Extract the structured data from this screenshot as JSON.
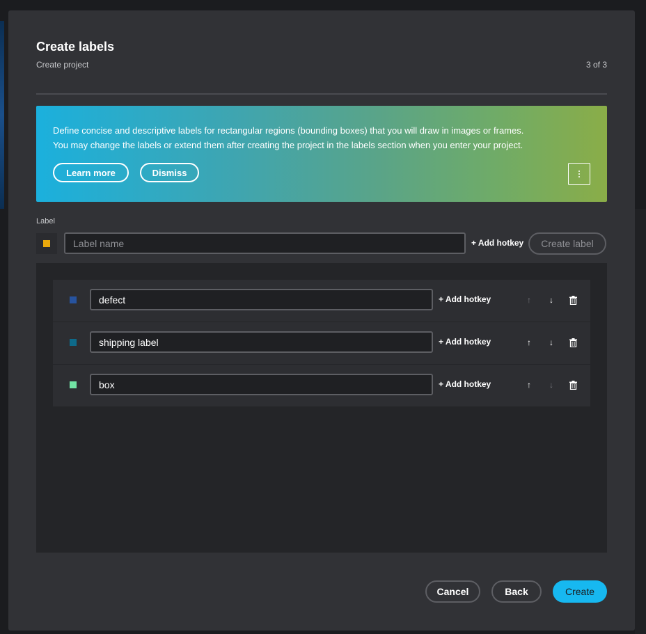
{
  "dialog": {
    "title": "Create labels",
    "subtitle": "Create project",
    "step": "3 of 3"
  },
  "banner": {
    "line1": "Define concise and descriptive labels for rectangular regions (bounding boxes) that you will draw in images or frames.",
    "line2": "You may change the labels or extend them after creating the project in the labels section when you enter your project.",
    "learn_more": "Learn more",
    "dismiss": "Dismiss",
    "more_icon": "kebab-menu-icon",
    "gradient_colors": [
      "#1bb0dd",
      "#8aad48"
    ]
  },
  "new_label": {
    "caption": "Label",
    "color": "#e9a80c",
    "placeholder": "Label name",
    "add_hotkey": "+ Add hotkey",
    "create_button": "Create label"
  },
  "labels": [
    {
      "name": "defect",
      "color": "#27539e",
      "add_hotkey": "+ Add hotkey",
      "up_enabled": false,
      "down_enabled": true
    },
    {
      "name": "shipping label",
      "color": "#0e6a8a",
      "add_hotkey": "+ Add hotkey",
      "up_enabled": true,
      "down_enabled": true
    },
    {
      "name": "box",
      "color": "#72e3a4",
      "add_hotkey": "+ Add hotkey",
      "up_enabled": true,
      "down_enabled": false
    }
  ],
  "icons": {
    "up": "↑",
    "down": "↓",
    "delete": "delete-icon"
  },
  "footer": {
    "cancel": "Cancel",
    "back": "Back",
    "create": "Create"
  },
  "colors": {
    "accent": "#17b8f0",
    "dialog_bg": "#313236"
  }
}
